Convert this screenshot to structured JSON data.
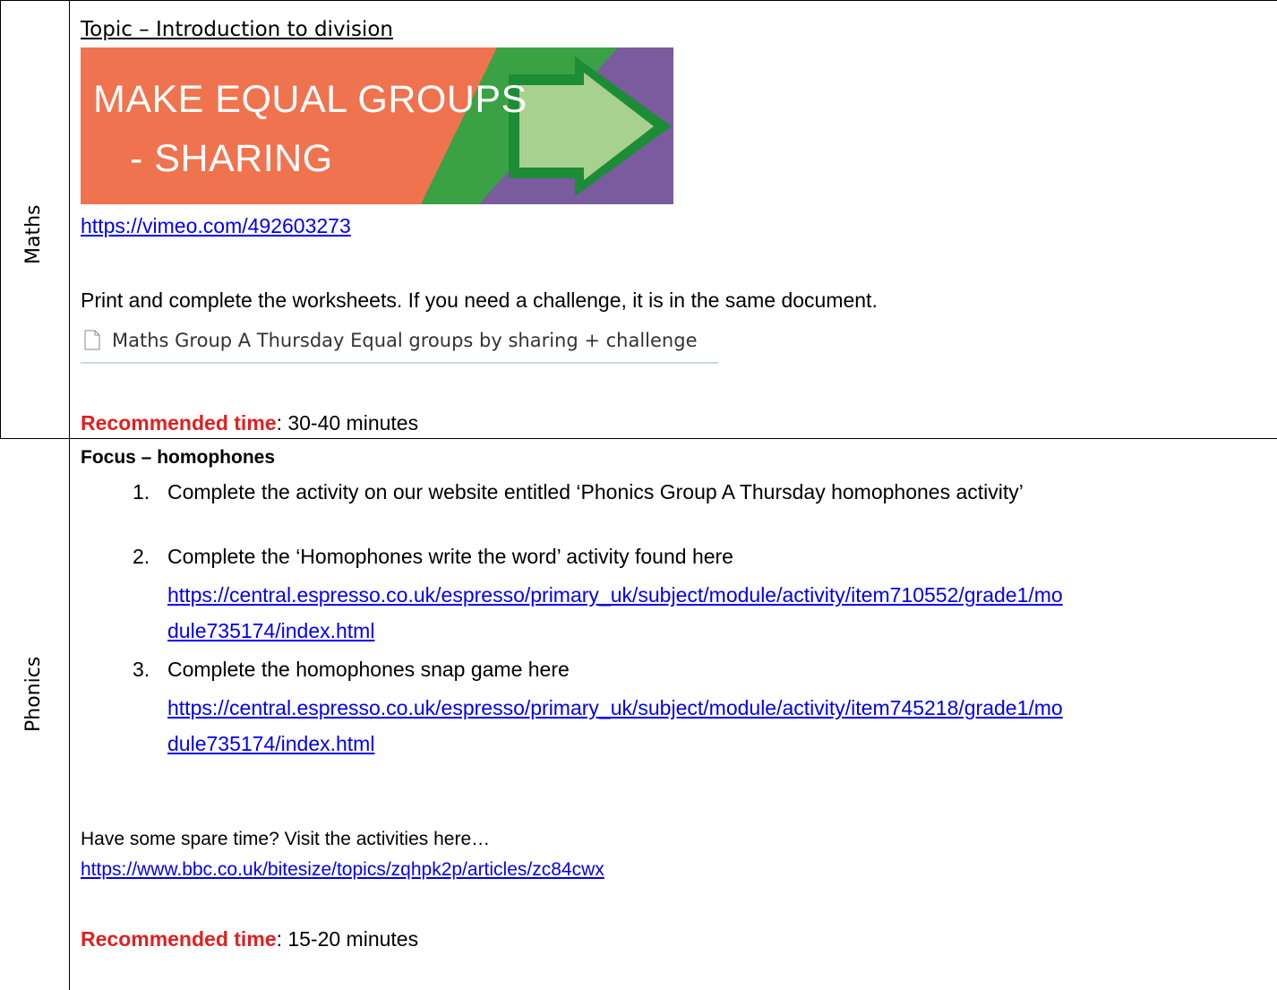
{
  "maths": {
    "subject_label": "Maths",
    "topic": "Topic – Introduction to division",
    "banner": {
      "line1": "MAKE EQUAL GROUPS",
      "line2": "- SHARING",
      "colors": {
        "orange": "#f0734f",
        "green": "#3aa244",
        "purple": "#7a5b9e",
        "arrow_fill": "#a8d08e",
        "arrow_border": "#1c8c36"
      }
    },
    "video_link": "https://vimeo.com/492603273",
    "instructions": "Print and complete the worksheets. If you need a challenge, it is in the same document.",
    "attachment": {
      "icon": "file-icon",
      "label": "Maths Group A Thursday Equal groups by sharing + challenge"
    },
    "recommended_label": "Recommended time",
    "recommended_value": ": 30-40 minutes"
  },
  "phonics": {
    "subject_label": "Phonics",
    "focus": "Focus – homophones",
    "items": [
      {
        "number": "1.",
        "text": "Complete the activity on our website entitled ‘Phonics Group A Thursday homophones activity’"
      },
      {
        "number": "2.",
        "text": "Complete the ‘Homophones write the word’ activity found here",
        "link_line1": "https://central.espresso.co.uk/espresso/primary_uk/subject/module/activity/item710552/grade1/mo",
        "link_line2": "dule735174/index.html"
      },
      {
        "number": "3.",
        "text": "Complete the homophones snap game here",
        "link_line1": "https://central.espresso.co.uk/espresso/primary_uk/subject/module/activity/item745218/grade1/mo",
        "link_line2": "dule735174/index.html"
      }
    ],
    "spare_time": "Have some spare time?  Visit the activities here…",
    "spare_link": "https://www.bbc.co.uk/bitesize/topics/zqhpk2p/articles/zc84cwx",
    "recommended_label": "Recommended time",
    "recommended_value": ": 15-20 minutes"
  },
  "colors": {
    "link": "#0000ee",
    "recommended": "#e02020"
  }
}
